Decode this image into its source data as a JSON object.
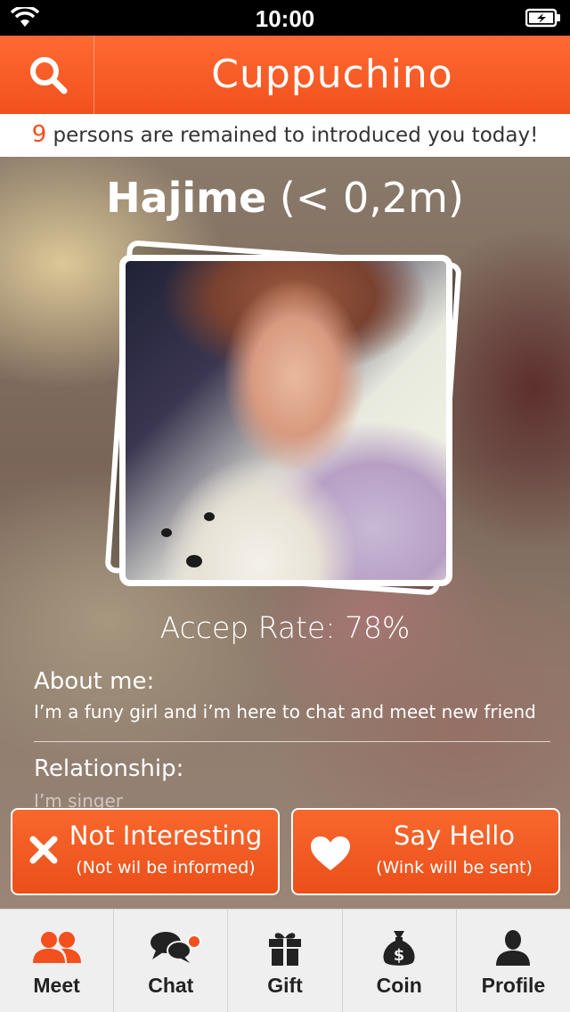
{
  "status_bar": {
    "time": "10:00",
    "icons": [
      "wifi-icon",
      "battery-charging-icon"
    ]
  },
  "header": {
    "title": "Cuppuchino",
    "search_icon": "search-icon"
  },
  "notice": {
    "count": "9",
    "text": " persons are remained to introduced you today!"
  },
  "profile": {
    "name": "Hajime",
    "distance": " (< 0,2m)",
    "accept_rate": "Accep Rate: 78%",
    "about_label": "About me:",
    "about_text": "I’m a funy girl and i’m here to chat and meet new friend",
    "relationship_label": "Relationship:",
    "relationship_text": "I’m singer"
  },
  "actions": {
    "not_interesting": {
      "label": "Not Interesting",
      "sub": "(Not wil be informed)",
      "icon": "close-icon"
    },
    "say_hello": {
      "label": "Say Hello",
      "sub": "(Wink will be sent)",
      "icon": "heart-icon"
    }
  },
  "tabs": [
    {
      "label": "Meet",
      "icon": "users-icon",
      "active": true
    },
    {
      "label": "Chat",
      "icon": "chat-bubbles-icon",
      "badge": true
    },
    {
      "label": "Gift",
      "icon": "gift-icon"
    },
    {
      "label": "Coin",
      "icon": "money-bag-icon"
    },
    {
      "label": "Profile",
      "icon": "user-icon"
    }
  ],
  "colors": {
    "accent": "#f2501d",
    "tab_active_icon": "#f2501d",
    "tab_icon": "#222222"
  }
}
